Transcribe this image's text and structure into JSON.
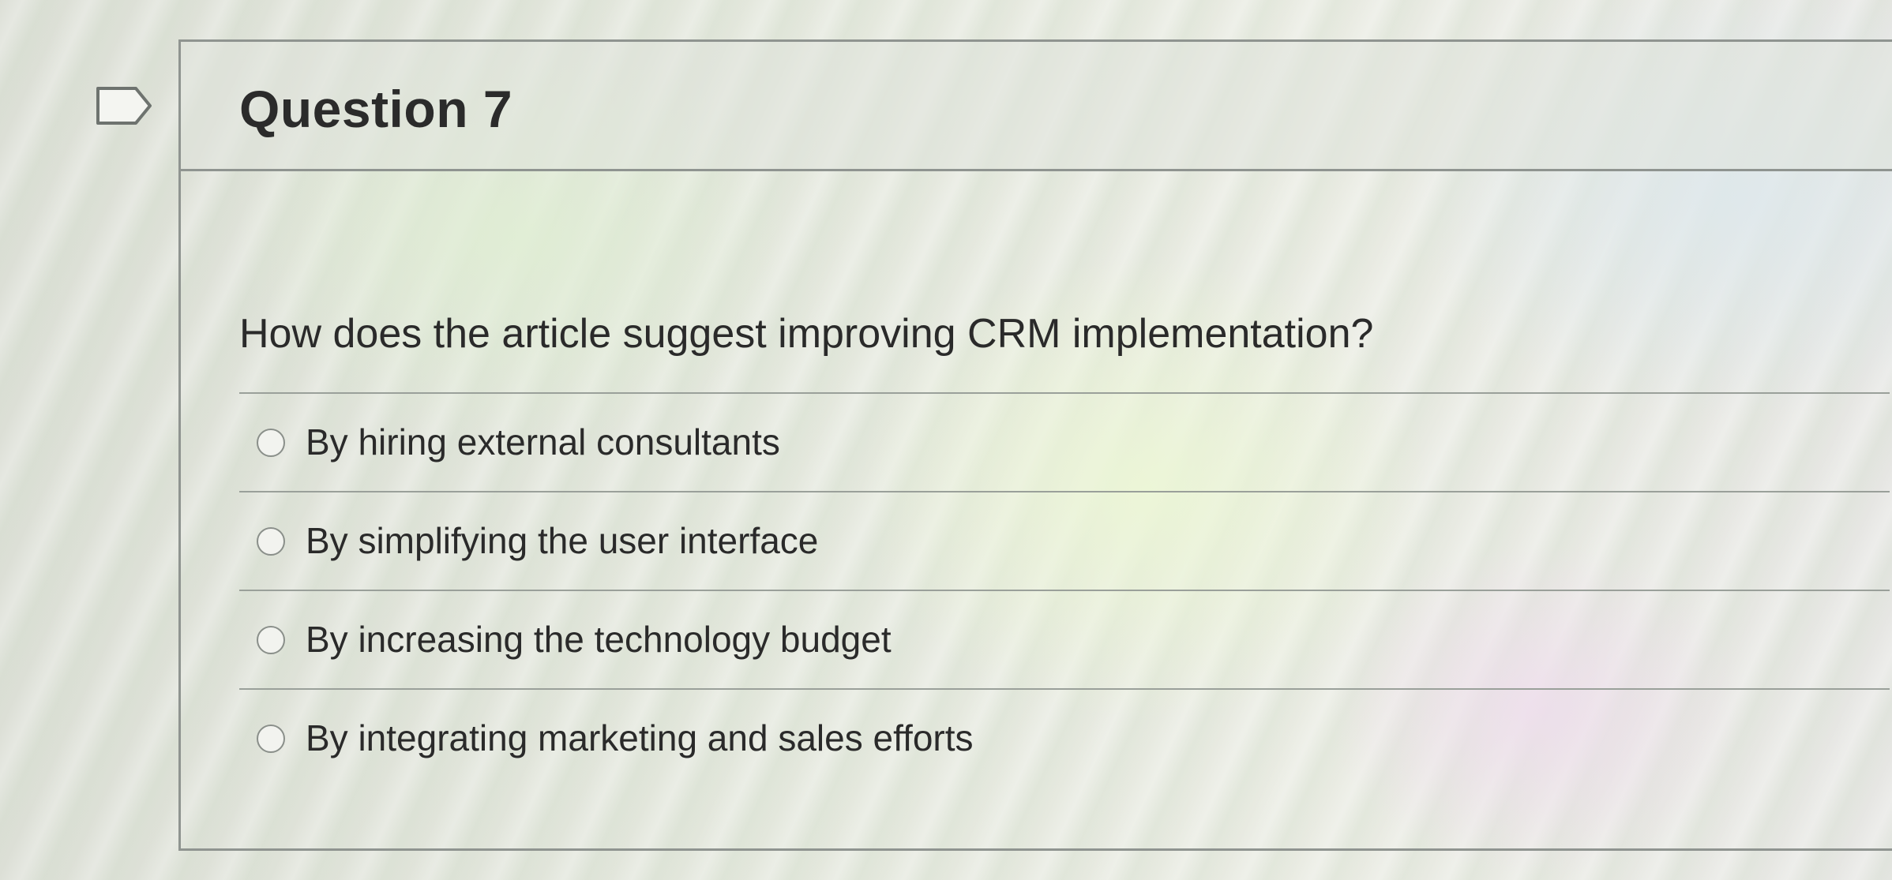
{
  "question": {
    "title": "Question 7",
    "prompt": "How does the article suggest improving CRM implementation?",
    "flag_icon": "bookmark-flag-icon",
    "options": [
      {
        "label": "By hiring external consultants",
        "selected": false
      },
      {
        "label": "By simplifying the user interface",
        "selected": false
      },
      {
        "label": "By increasing the technology budget",
        "selected": false
      },
      {
        "label": "By integrating marketing and sales efforts",
        "selected": false
      }
    ]
  },
  "colors": {
    "text": "#2a2a2a",
    "border": "#8f9490",
    "radio_border": "#8a8f8a"
  }
}
